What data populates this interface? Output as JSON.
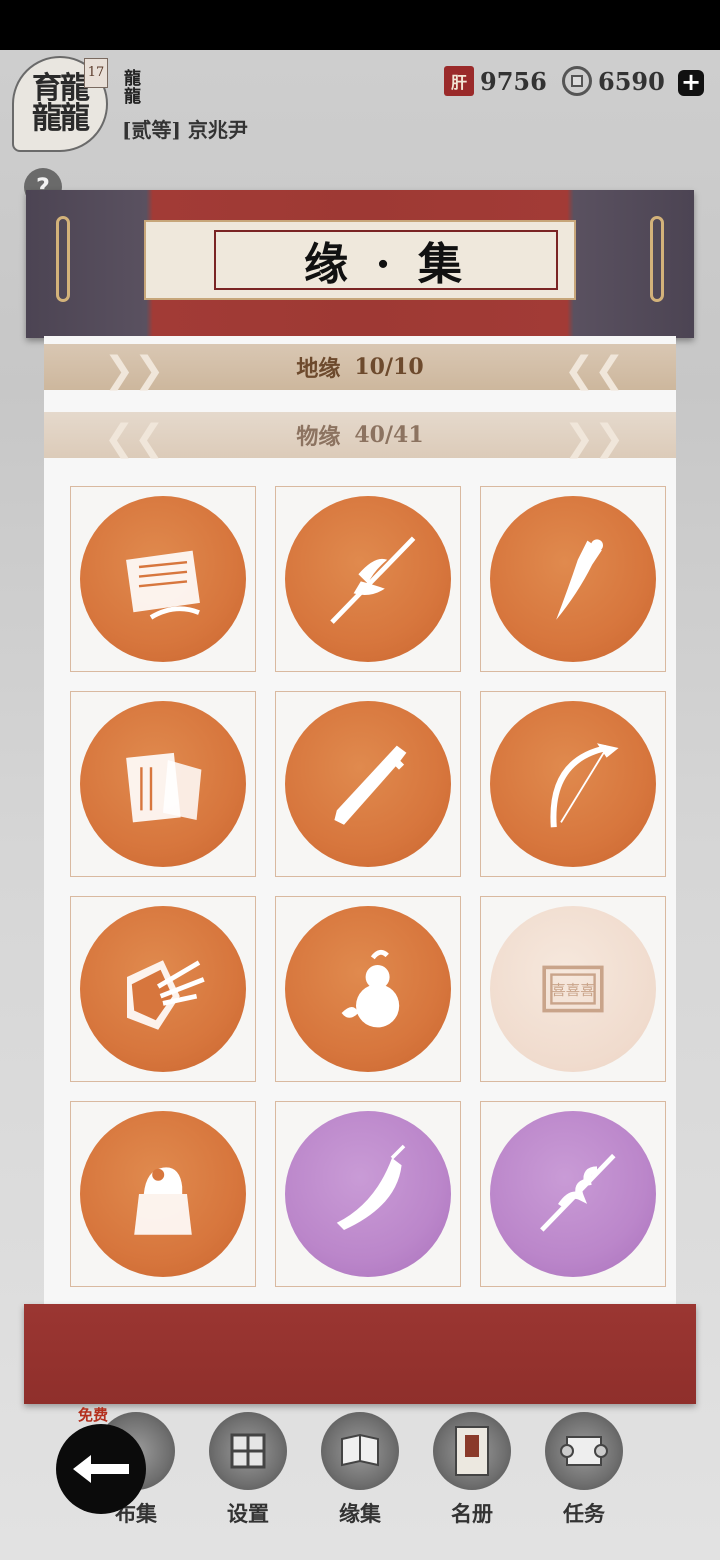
{
  "player": {
    "avatar_text": "育龍龍龍",
    "level": "17",
    "name": "龍龍",
    "rank": "[贰等] 京兆尹"
  },
  "currency": {
    "seal_icon_text": "肝",
    "seal_value": "9756",
    "coin_value": "6590",
    "plus_label": "+"
  },
  "help_label": "?",
  "title": "缘 · 集",
  "sections": {
    "land": {
      "label": "地缘",
      "count": "10/10"
    },
    "item": {
      "label": "物缘",
      "count": "40/41"
    }
  },
  "cards": [
    {
      "icon": "scroll-document-icon",
      "color": "orange"
    },
    {
      "icon": "halberd-icon",
      "color": "orange"
    },
    {
      "icon": "dagger-icon",
      "color": "orange"
    },
    {
      "icon": "bamboo-scroll-icon",
      "color": "orange"
    },
    {
      "icon": "sword-icon",
      "color": "orange"
    },
    {
      "icon": "bow-icon",
      "color": "orange"
    },
    {
      "icon": "shield-arrows-icon",
      "color": "orange"
    },
    {
      "icon": "gourd-icon",
      "color": "orange"
    },
    {
      "icon": "seal-plaque-icon",
      "color": "faded"
    },
    {
      "icon": "jade-seal-icon",
      "color": "orange"
    },
    {
      "icon": "glaive-icon",
      "color": "purple"
    },
    {
      "icon": "serpent-spear-icon",
      "color": "purple"
    }
  ],
  "nav": {
    "free_tag": "免费",
    "items": [
      "布集",
      "设置",
      "缘集",
      "名册",
      "任务"
    ]
  },
  "colors": {
    "orange": "#d7763d",
    "purple": "#bb86ca",
    "faded": "#f0dbcd",
    "scroll_red": "#9e3934"
  }
}
